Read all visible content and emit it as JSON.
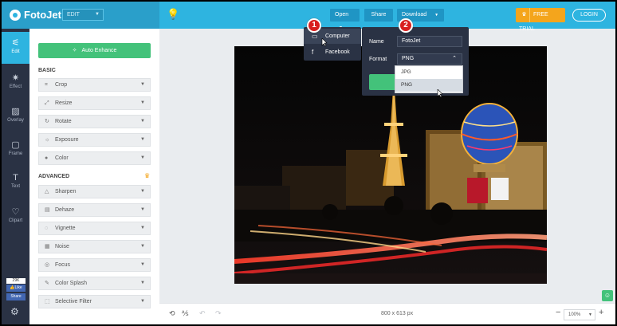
{
  "app": {
    "name": "FotoJet",
    "mode_select": "EDIT"
  },
  "topbar": {
    "open_label": "Open",
    "share_label": "Share",
    "download_label": "Download",
    "trial_label": "FREE TRIAL",
    "login_label": "LOGIN"
  },
  "rail": [
    {
      "label": "Edit",
      "icon": "sliders-icon",
      "glyph": "⚟"
    },
    {
      "label": "Effect",
      "icon": "effect-icon",
      "glyph": "✷"
    },
    {
      "label": "Overlay",
      "icon": "overlay-icon",
      "glyph": "▨"
    },
    {
      "label": "Frame",
      "icon": "frame-icon",
      "glyph": "▢"
    },
    {
      "label": "Text",
      "icon": "text-icon",
      "glyph": "T"
    },
    {
      "label": "Clipart",
      "icon": "heart-icon",
      "glyph": "♡"
    }
  ],
  "facebook": {
    "count": "29K",
    "like_label": "Like",
    "share_label": "Share"
  },
  "panel": {
    "auto_enhance_label": "Auto Enhance",
    "basic_heading": "BASIC",
    "advanced_heading": "ADVANCED",
    "basic_tools": [
      {
        "label": "Crop",
        "icon": "crop-icon",
        "glyph": "⌗"
      },
      {
        "label": "Resize",
        "icon": "resize-icon",
        "glyph": "⤢"
      },
      {
        "label": "Rotate",
        "icon": "rotate-icon",
        "glyph": "↻"
      },
      {
        "label": "Exposure",
        "icon": "sun-icon",
        "glyph": "☼"
      },
      {
        "label": "Color",
        "icon": "drop-icon",
        "glyph": "●"
      }
    ],
    "advanced_tools": [
      {
        "label": "Sharpen",
        "icon": "triangle-icon",
        "glyph": "△"
      },
      {
        "label": "Dehaze",
        "icon": "dehaze-icon",
        "glyph": "▤"
      },
      {
        "label": "Vignette",
        "icon": "vignette-icon",
        "glyph": "◌"
      },
      {
        "label": "Noise",
        "icon": "noise-icon",
        "glyph": "▦"
      },
      {
        "label": "Focus",
        "icon": "focus-icon",
        "glyph": "◎"
      },
      {
        "label": "Color Splash",
        "icon": "brush-icon",
        "glyph": "✎"
      },
      {
        "label": "Selective Filter",
        "icon": "selection-icon",
        "glyph": "⬚"
      }
    ]
  },
  "open_menu": {
    "items": [
      {
        "label": "Computer",
        "icon": "monitor-icon",
        "glyph": "▭"
      },
      {
        "label": "Facebook",
        "icon": "facebook-icon",
        "glyph": "f"
      }
    ]
  },
  "download_panel": {
    "name_label": "Name",
    "name_value": "FotoJet",
    "format_label": "Format",
    "format_value": "PNG",
    "format_options": [
      "JPG",
      "PNG"
    ]
  },
  "badges": {
    "first": "1",
    "second": "2"
  },
  "canvas": {
    "dimensions": "800 x 613 px",
    "zoom": "100%"
  },
  "colors": {
    "accent": "#2eb4e0",
    "rail": "#2a3244",
    "green": "#43c27a",
    "trial": "#f4a51c",
    "badge": "#d81f1f"
  }
}
